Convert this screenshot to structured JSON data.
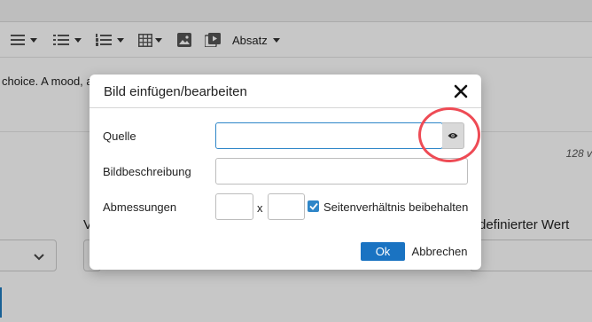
{
  "toolbar": {
    "items": [
      {
        "icon": "align-justify-icon"
      },
      {
        "icon": "bullet-list-icon"
      },
      {
        "icon": "numbered-list-icon"
      },
      {
        "icon": "table-icon"
      },
      {
        "icon": "image-icon"
      },
      {
        "icon": "media-icon"
      }
    ],
    "format_label": "Absatz"
  },
  "editor": {
    "text": "choice. A mood, a"
  },
  "background": {
    "word_count": "128 v",
    "field_label_left": "V",
    "field_label_right": "definierter Wert"
  },
  "dialog": {
    "title": "Bild einfügen/bearbeiten",
    "close_icon": "close-icon",
    "source": {
      "label": "Quelle",
      "value": "",
      "browse_icon": "eye-icon"
    },
    "description": {
      "label": "Bildbeschreibung",
      "value": ""
    },
    "dimensions": {
      "label": "Abmessungen",
      "width_value": "",
      "separator": "x",
      "height_value": "",
      "keep_ratio_label": "Seitenverhältnis beibehalten",
      "keep_ratio_checked": true
    },
    "ok_label": "Ok",
    "cancel_label": "Abbrechen"
  },
  "colors": {
    "accent": "#1a73c2",
    "highlight": "#ee4b55",
    "overlay": "rgba(0,0,0,0.22)"
  }
}
